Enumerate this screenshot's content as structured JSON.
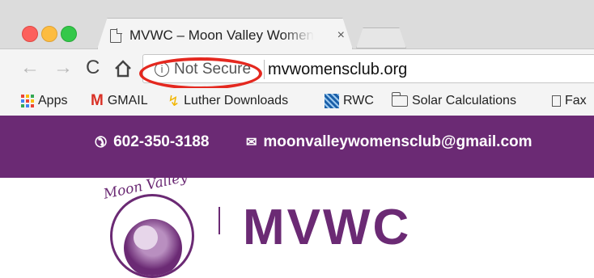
{
  "browser": {
    "tab_title": "MVWC – Moon Valley Women's Club",
    "tab_close": "×",
    "nav": {
      "back": "←",
      "forward": "→",
      "reload": "C"
    },
    "security_label": "Not Secure",
    "url": "mvwomensclub.org",
    "highlight_color": "#e4281f"
  },
  "bookmarks": [
    {
      "label": "Apps",
      "icon": "apps-grid-icon"
    },
    {
      "label": "GMAIL",
      "icon": "gmail-icon"
    },
    {
      "label": "Luther Downloads",
      "icon": "luther-icon"
    },
    {
      "label": "RWC",
      "icon": "rwc-icon"
    },
    {
      "label": "Solar Calculations",
      "icon": "folder-icon"
    },
    {
      "label": "Fax",
      "icon": "page-icon"
    }
  ],
  "site": {
    "phone": "602-350-3188",
    "email": "moonvalleywomensclub@gmail.com",
    "logo_text": "Moon Valley",
    "brand": "MVWC",
    "brand_color": "#6b2a74"
  }
}
